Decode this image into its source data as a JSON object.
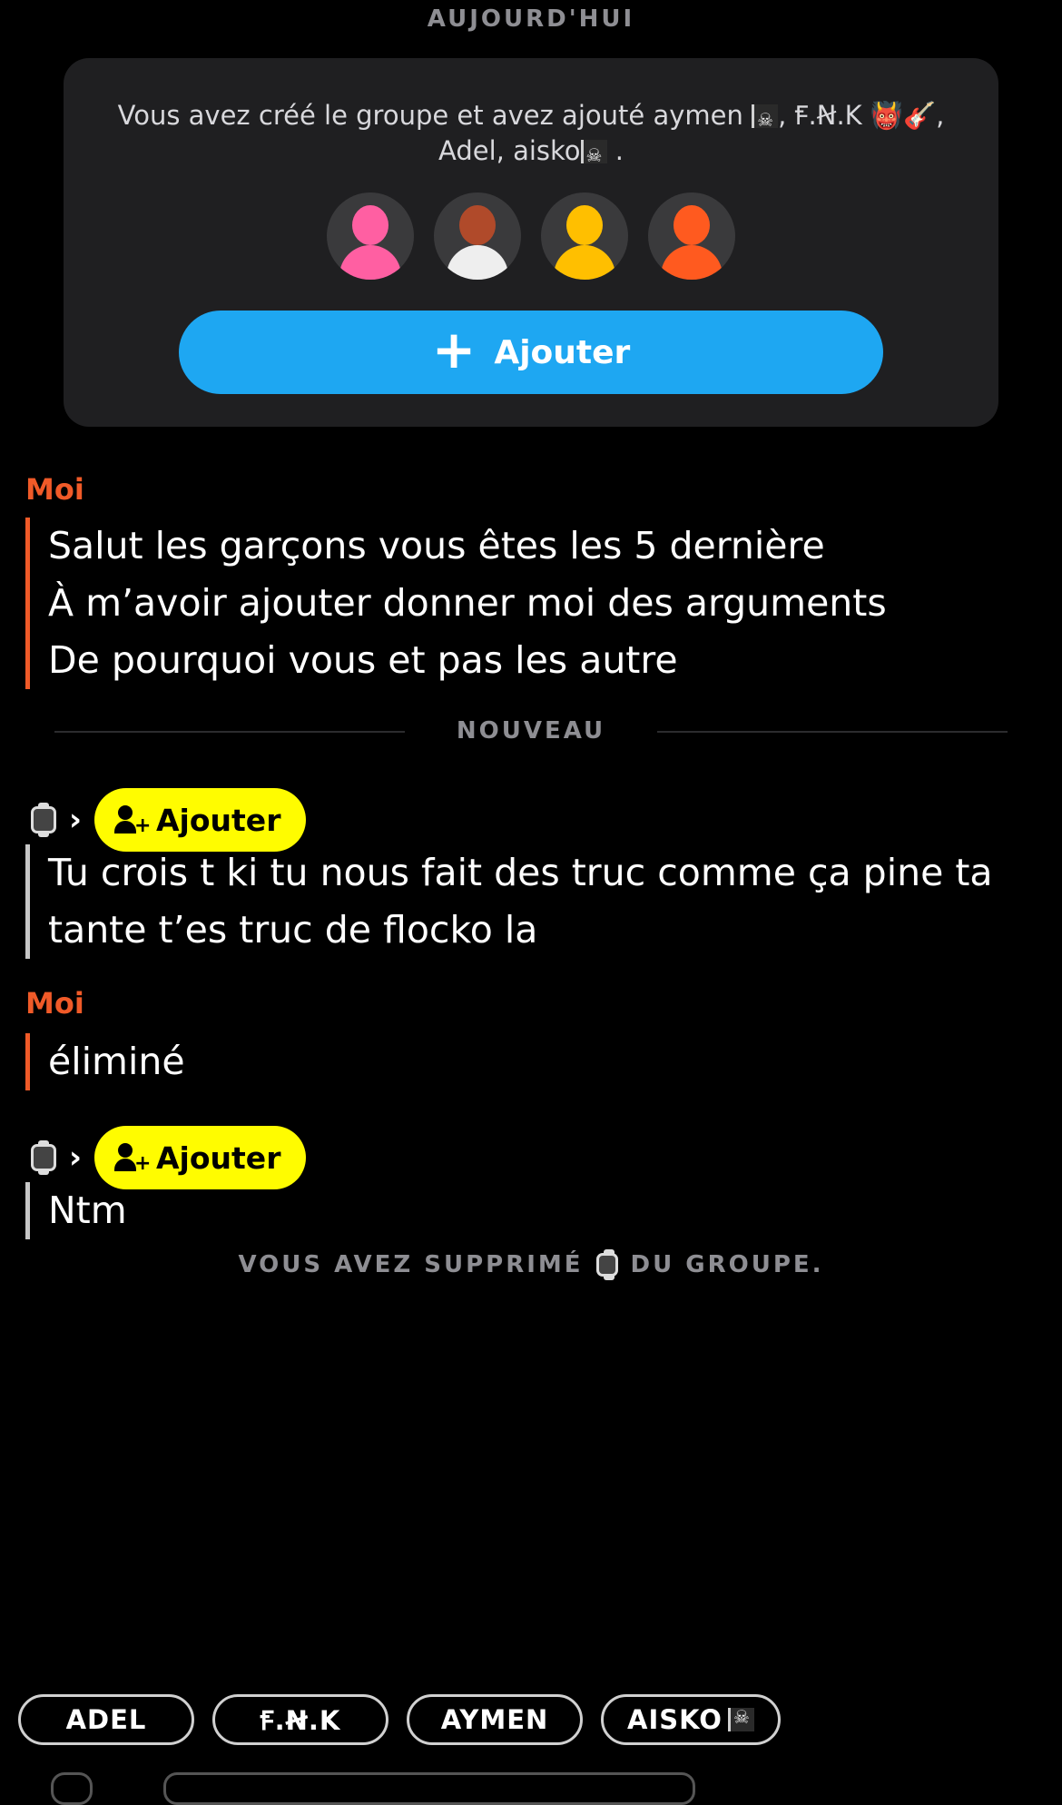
{
  "date_header": "AUJOURD'HUI",
  "group_card": {
    "text_line1": "Vous avez créé le groupe et avez ajouté aymen",
    "text_mid": ", Ꞙ.Ꞥ.K",
    "text_emoji": "👹🎸",
    "text_end": ",",
    "text_line2": "Adel, aisko",
    "text_line2_end": ".",
    "avatars": [
      {
        "name": "avatar-pink",
        "color": "#ff5fa2"
      },
      {
        "name": "avatar-bitmoji",
        "color": "#b04a2a"
      },
      {
        "name": "avatar-yellow",
        "color": "#ffbf00"
      },
      {
        "name": "avatar-orange",
        "color": "#ff5a1f"
      }
    ],
    "add_button_label": "Ajouter",
    "add_button_icon": "plus-icon"
  },
  "messages": {
    "m1_sender": "Moi",
    "m1_lines": [
      "Salut les garçons vous êtes les 5 dernière",
      "À m’avoir ajouter donner moi des arguments",
      "De pourquoi vous et pas les autre"
    ],
    "divider_label": "NOUVEAU",
    "m2_chip": "Ajouter",
    "m2_lines": [
      "Tu crois t ki tu nous fait des truc comme ça pine ta",
      "tante t’es truc de flocko la"
    ],
    "m3_sender": "Moi",
    "m3_text": "éliminé",
    "m4_chip": "Ajouter",
    "m4_text": "Ntm",
    "system_before": "VOUS AVEZ SUPPRIMÉ",
    "system_after": "DU GROUPE."
  },
  "mention_pills": [
    "ADEL",
    "Ꞙ.Ꞥ.K",
    "AYMEN",
    "AISKO"
  ],
  "colors": {
    "accent_blue": "#1ea7f2",
    "me_orange": "#f05a28",
    "snap_yellow": "#fffc00"
  }
}
